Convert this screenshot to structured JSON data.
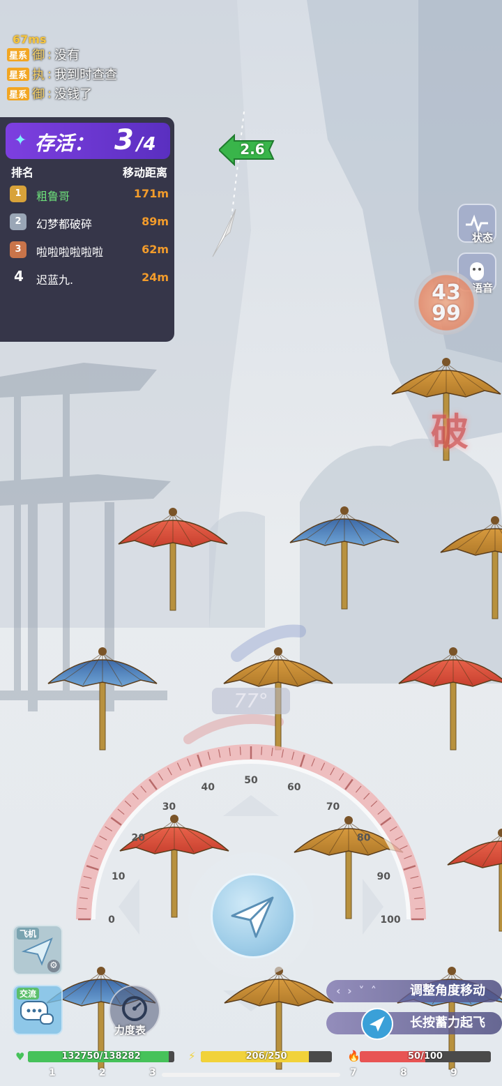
{
  "ping": "67ms",
  "chat": [
    {
      "tag": "星系",
      "who": "御",
      "sep": ":",
      "msg": "没有"
    },
    {
      "tag": "星系",
      "who": "执",
      "sep": ":",
      "msg": "我到时查查"
    },
    {
      "tag": "星系",
      "who": "御",
      "sep": ":",
      "msg": "没钱了"
    }
  ],
  "survival": {
    "label": "存活：",
    "current": "3",
    "total": "/4",
    "col_rank": "排名",
    "col_distance": "移动距离",
    "rows": [
      {
        "rank": "1",
        "name": "粗鲁哥",
        "distance": "171m",
        "highlight": true
      },
      {
        "rank": "2",
        "name": "幻梦都破碎",
        "distance": "89m"
      },
      {
        "rank": "3",
        "name": "啦啦啦啦啦啦",
        "distance": "62m"
      },
      {
        "rank": "4",
        "name": "迟蓝九.",
        "distance": "24m"
      }
    ]
  },
  "distance_marker": "2.6",
  "side": {
    "status_label": "状态",
    "voice_label": "语音"
  },
  "counter": {
    "top": "43",
    "bottom": "99"
  },
  "break_glyph": "破",
  "gauge": {
    "readout": "77°",
    "value_deg": 77,
    "ticks": [
      "0",
      "10",
      "20",
      "30",
      "40",
      "50",
      "60",
      "70",
      "80",
      "90",
      "100"
    ]
  },
  "buttons": {
    "plane_tab": "飞机",
    "chat_tab": "交流",
    "power_meter": "力度表"
  },
  "hints": {
    "adjust": "调整角度移动",
    "hold": "长按蓄力起飞"
  },
  "stats": {
    "hp": {
      "text": "132750/138282",
      "fraction": 0.96,
      "color": "#46c25a"
    },
    "energy": {
      "text": "206/250",
      "fraction": 0.824,
      "color": "#f1d23a"
    },
    "rage": {
      "text": "50/100",
      "fraction": 0.5,
      "color": "#e85454"
    }
  },
  "slots": [
    "1",
    "2",
    "3",
    "7",
    "8",
    "9"
  ]
}
